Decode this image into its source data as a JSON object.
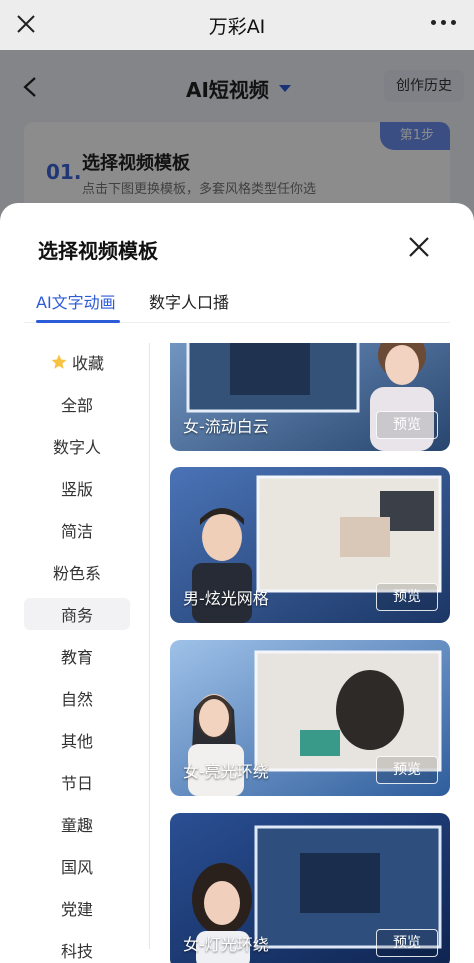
{
  "appbar": {
    "title": "万彩AI"
  },
  "bgpage": {
    "nav_title": "AI短视频",
    "history_label": "创作历史",
    "step_badge": "第1步",
    "step_num": "01.",
    "step_title": "选择视频模板",
    "step_desc": "点击下图更换模板，多套风格类型任你选"
  },
  "sheet": {
    "title": "选择视频模板",
    "tabs": [
      {
        "label": "AI文字动画",
        "active": true
      },
      {
        "label": "数字人口播",
        "active": false
      }
    ],
    "categories": [
      {
        "label": "收藏",
        "icon": "star-icon"
      },
      {
        "label": "全部"
      },
      {
        "label": "数字人"
      },
      {
        "label": "竖版"
      },
      {
        "label": "简洁"
      },
      {
        "label": "粉色系"
      },
      {
        "label": "商务",
        "active": true
      },
      {
        "label": "教育"
      },
      {
        "label": "自然"
      },
      {
        "label": "其他"
      },
      {
        "label": "节日"
      },
      {
        "label": "童趣"
      },
      {
        "label": "国风"
      },
      {
        "label": "党建"
      },
      {
        "label": "科技"
      }
    ],
    "templates": [
      {
        "name": "女-流动白云",
        "preview": "预览"
      },
      {
        "name": "男-炫光网格",
        "preview": "预览"
      },
      {
        "name": "女-亮光环绕",
        "preview": "预览"
      },
      {
        "name": "女-灯光环绕",
        "preview": "预览"
      }
    ]
  },
  "colors": {
    "accent": "#2c5bd8",
    "badge": "#6b8ef0"
  }
}
